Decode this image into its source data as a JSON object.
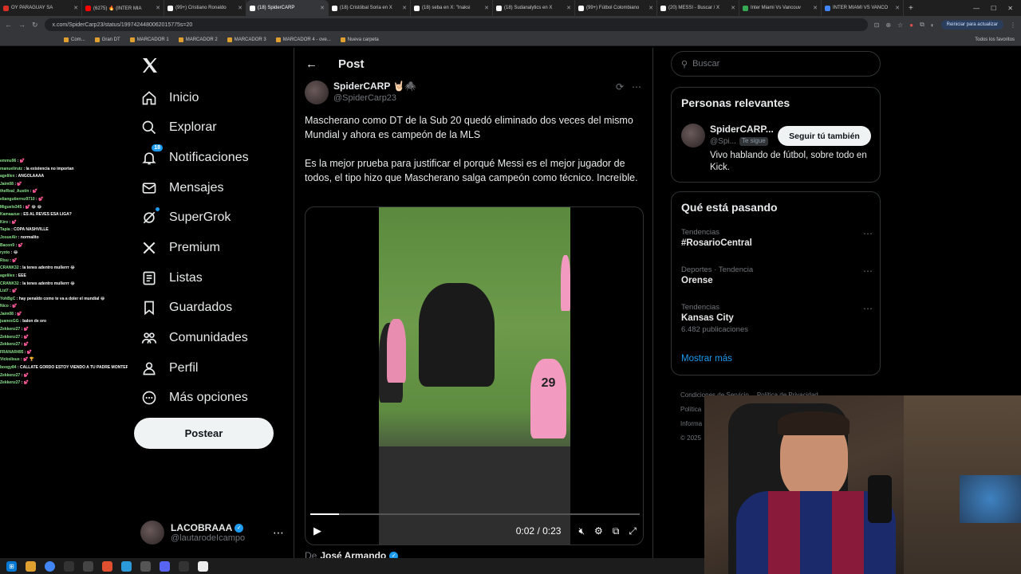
{
  "browser": {
    "tabs": [
      {
        "title": "OY PARAGUAY SA",
        "favicon_color": "#d93025"
      },
      {
        "title": "(6275) 🔥 (INTER MIA",
        "favicon_color": "#ff0000"
      },
      {
        "title": "(99+) Cristiano Ronaldo",
        "favicon_color": "#ffffff"
      },
      {
        "title": "(18) SpiderCARP",
        "favicon_color": "#ffffff",
        "active": true
      },
      {
        "title": "(18) Cristóbal Soria en X",
        "favicon_color": "#ffffff"
      },
      {
        "title": "(18) seba en X: \"Inaksi",
        "favicon_color": "#ffffff"
      },
      {
        "title": "(18) Sudanalytics en X",
        "favicon_color": "#ffffff"
      },
      {
        "title": "(99+) Fútbol Colombiano",
        "favicon_color": "#ffffff"
      },
      {
        "title": "(20) MESSI - Buscar / X",
        "favicon_color": "#ffffff"
      },
      {
        "title": "Inter Miami Vs Vancouv",
        "favicon_color": "#34a853"
      },
      {
        "title": "INTER MIAMI VS VANCO",
        "favicon_color": "#4285f4"
      }
    ],
    "url": "x.com/SpiderCarp23/status/1997424480062015775s=20",
    "update_button": "Reiniciar para actualizar",
    "bookmarks": [
      "Com...",
      "Gran DT",
      "MARCADOR 1",
      "MARCADOR 2",
      "MARCADOR 3",
      "MARCADOR 4 - ove...",
      "Nueva carpeta"
    ],
    "all_bookmarks": "Todos los favoritos"
  },
  "chat": [
    {
      "user": "emmu96",
      "msg": "💕"
    },
    {
      "user": "manuelirutz",
      "msg": "la existencia no importan"
    },
    {
      "user": "agelilex",
      "msg": "ANGOLAAAA"
    },
    {
      "user": "Jaim08",
      "msg": "💕"
    },
    {
      "user": "theReal_Austin",
      "msg": "💕"
    },
    {
      "user": "eliangutierrez9710",
      "msg": "💕"
    },
    {
      "user": "Miguelo345",
      "msg": "💕 😂 😂"
    },
    {
      "user": "Kamaazue",
      "msg": "ES AL REVES ESA LIGA?"
    },
    {
      "user": "Kiro",
      "msg": "💕"
    },
    {
      "user": "Tapia",
      "msg": "COPA NASHVILLE"
    },
    {
      "user": "JosueAlr",
      "msg": "normalito"
    },
    {
      "user": "Bacon9",
      "msg": "💕"
    },
    {
      "user": "ryxto",
      "msg": "😂"
    },
    {
      "user": "Risu",
      "msg": "💕"
    },
    {
      "user": "CRANK32",
      "msg": "la tenes adentro mullerrr 😂"
    },
    {
      "user": "agelilex",
      "msg": "EEE"
    },
    {
      "user": "CRANK32",
      "msg": "la tenes adentro mullerrr 😂"
    },
    {
      "user": "Ltd7",
      "msg": "💕"
    },
    {
      "user": "YohBgC",
      "msg": "hay penaldo como te va a doler el mundial 😂"
    },
    {
      "user": "Nico",
      "msg": "💕"
    },
    {
      "user": "Jaim08",
      "msg": "💕"
    },
    {
      "user": "juanesGG",
      "msg": "balon de oro"
    },
    {
      "user": "Zekkenz27",
      "msg": "💕"
    },
    {
      "user": "Zekkenz27",
      "msg": "💕"
    },
    {
      "user": "Zekkenz27",
      "msg": "💕"
    },
    {
      "user": "FRANAR495",
      "msg": "💕"
    },
    {
      "user": "Vickolisus",
      "msg": "💕 🏆"
    },
    {
      "user": "boogy84",
      "msg": "CALLATE GORDO ESTOY VIENDO A TU PADRE MONTERREY VS TOLUCA"
    },
    {
      "user": "Zekkenz27",
      "msg": "💕"
    },
    {
      "user": "Zekkenz27",
      "msg": "💕"
    }
  ],
  "sidebar": {
    "nav": [
      {
        "label": "Inicio",
        "icon": "home-icon"
      },
      {
        "label": "Explorar",
        "icon": "search-icon"
      },
      {
        "label": "Notificaciones",
        "icon": "bell-icon",
        "badge": "18"
      },
      {
        "label": "Mensajes",
        "icon": "mail-icon"
      },
      {
        "label": "SuperGrok",
        "icon": "grok-icon"
      },
      {
        "label": "Premium",
        "icon": "x-icon"
      },
      {
        "label": "Listas",
        "icon": "list-icon"
      },
      {
        "label": "Guardados",
        "icon": "bookmark-icon"
      },
      {
        "label": "Comunidades",
        "icon": "people-icon"
      },
      {
        "label": "Perfil",
        "icon": "person-icon"
      },
      {
        "label": "Más opciones",
        "icon": "more-icon"
      }
    ],
    "post_button": "Postear",
    "account": {
      "name": "LACOBRAAA",
      "handle": "@lautarodeIcampo"
    }
  },
  "post": {
    "header": "Post",
    "author_name": "SpiderCARP 🤘🏻🕷️",
    "author_handle": "@SpiderCarp23",
    "text_1": "Mascherano como DT de la Sub 20 quedó eliminado dos veces del mismo Mundial y ahora es campeón de la MLS",
    "text_2": "Es la mejor prueba para justificar el porqué Messi es el mejor jugador de todos, el tipo hizo que Mascherano salga campeón como técnico. Increíble.",
    "video": {
      "current_time": "0:02",
      "duration": "0:23",
      "progress": 0.087,
      "player_number": "29"
    },
    "reply_prefix": "De",
    "reply_author": "José Armando"
  },
  "right": {
    "search_placeholder": "Buscar",
    "relevant_title": "Personas relevantes",
    "relevant": {
      "name": "SpiderCARP...",
      "handle": "@Spi...",
      "follows_you": "Te sigue",
      "button": "Seguir tú también",
      "bio": "Vivo hablando de fútbol, sobre todo en Kick."
    },
    "trending_title": "Qué está pasando",
    "trends": [
      {
        "meta": "Tendencias",
        "name": "#RosarioCentral",
        "count": ""
      },
      {
        "meta": "Deportes · Tendencia",
        "name": "Orense",
        "count": ""
      },
      {
        "meta": "Tendencias",
        "name": "Kansas City",
        "count": "6.482 publicaciones"
      }
    ],
    "show_more": "Mostrar más",
    "footer": [
      "Condiciones de Servicio",
      "Política de Privacidad",
      "Política",
      "Informa",
      "© 2025"
    ]
  },
  "colors": {
    "accent": "#1d9bf0",
    "background": "#000000",
    "border": "#2f3336",
    "muted": "#71767b"
  }
}
